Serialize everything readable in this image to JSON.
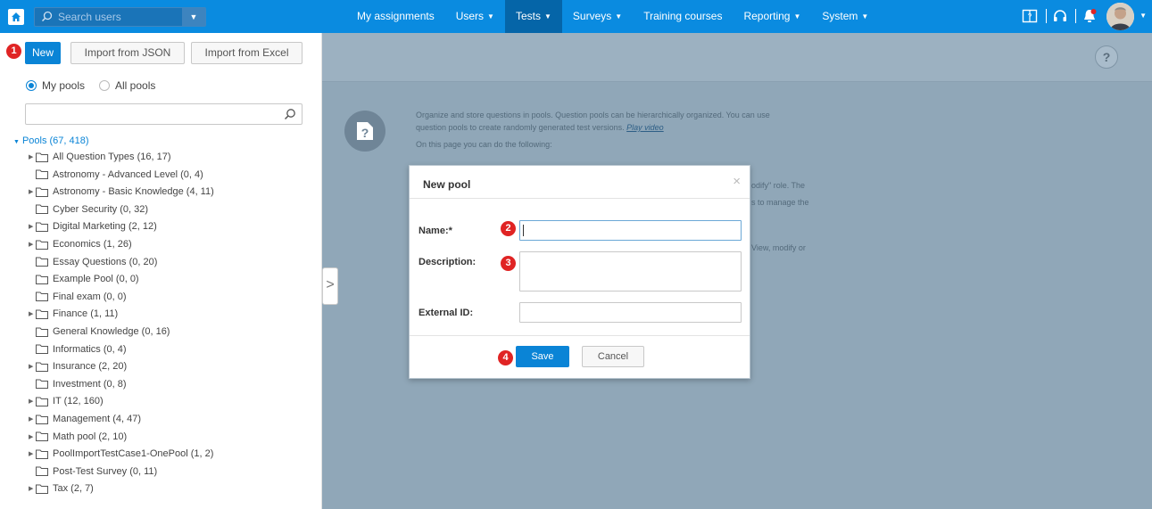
{
  "topbar": {
    "search_placeholder": "Search users",
    "nav": [
      {
        "label": "My assignments",
        "has_menu": false,
        "active": false
      },
      {
        "label": "Users",
        "has_menu": true,
        "active": false
      },
      {
        "label": "Tests",
        "has_menu": true,
        "active": true
      },
      {
        "label": "Surveys",
        "has_menu": true,
        "active": false
      },
      {
        "label": "Training courses",
        "has_menu": false,
        "active": false
      },
      {
        "label": "Reporting",
        "has_menu": true,
        "active": false
      },
      {
        "label": "System",
        "has_menu": true,
        "active": false
      }
    ],
    "icons": [
      "book-icon",
      "headset-icon",
      "bell-icon",
      "avatar"
    ],
    "brand_color": "#0a8be0",
    "active_color": "#0565a8"
  },
  "left": {
    "buttons": {
      "new": "New",
      "import_json": "Import from JSON",
      "import_excel": "Import from Excel"
    },
    "radios": {
      "my_pools": "My pools",
      "all_pools": "All pools",
      "selected": "my_pools"
    },
    "filter_value": "",
    "pools_root": "Pools (67, 418)",
    "pools": [
      {
        "label": "All Question Types (16, 17)",
        "expandable": true
      },
      {
        "label": "Astronomy - Advanced Level (0, 4)",
        "expandable": false
      },
      {
        "label": "Astronomy - Basic Knowledge (4, 11)",
        "expandable": true
      },
      {
        "label": "Cyber Security (0, 32)",
        "expandable": false
      },
      {
        "label": "Digital Marketing (2, 12)",
        "expandable": true
      },
      {
        "label": "Economics (1, 26)",
        "expandable": true
      },
      {
        "label": "Essay Questions (0, 20)",
        "expandable": false
      },
      {
        "label": "Example Pool (0, 0)",
        "expandable": false
      },
      {
        "label": "Final exam (0, 0)",
        "expandable": false
      },
      {
        "label": "Finance (1, 11)",
        "expandable": true
      },
      {
        "label": "General Knowledge (0, 16)",
        "expandable": false
      },
      {
        "label": "Informatics (0, 4)",
        "expandable": false
      },
      {
        "label": "Insurance (2, 20)",
        "expandable": true
      },
      {
        "label": "Investment (0, 8)",
        "expandable": false
      },
      {
        "label": "IT (12, 160)",
        "expandable": true
      },
      {
        "label": "Management (4, 47)",
        "expandable": true
      },
      {
        "label": "Math pool (2, 10)",
        "expandable": true
      },
      {
        "label": "PoolImportTestCase1-OnePool (1, 2)",
        "expandable": true
      },
      {
        "label": "Post-Test Survey (0, 11)",
        "expandable": false
      },
      {
        "label": "Tax (2, 7)",
        "expandable": true
      }
    ]
  },
  "main": {
    "help_label": "?",
    "info": {
      "line1": "Organize and store questions in pools. Question pools can be hierarchically organized. You can use",
      "line2": "question pools to create randomly generated test versions.",
      "video_link": "Play video",
      "line3": "On this page you can do the following:",
      "frag1": "odify\" role. The",
      "frag2": "s to manage the",
      "frag3": "View, modify or"
    }
  },
  "modal": {
    "title": "New pool",
    "close": "×",
    "name_label": "Name:*",
    "name_value": "",
    "description_label": "Description:",
    "description_value": "",
    "external_id_label": "External ID:",
    "external_id_value": "",
    "save_label": "Save",
    "cancel_label": "Cancel"
  },
  "markers": [
    "1",
    "2",
    "3",
    "4"
  ],
  "marker_color": "#e02424"
}
